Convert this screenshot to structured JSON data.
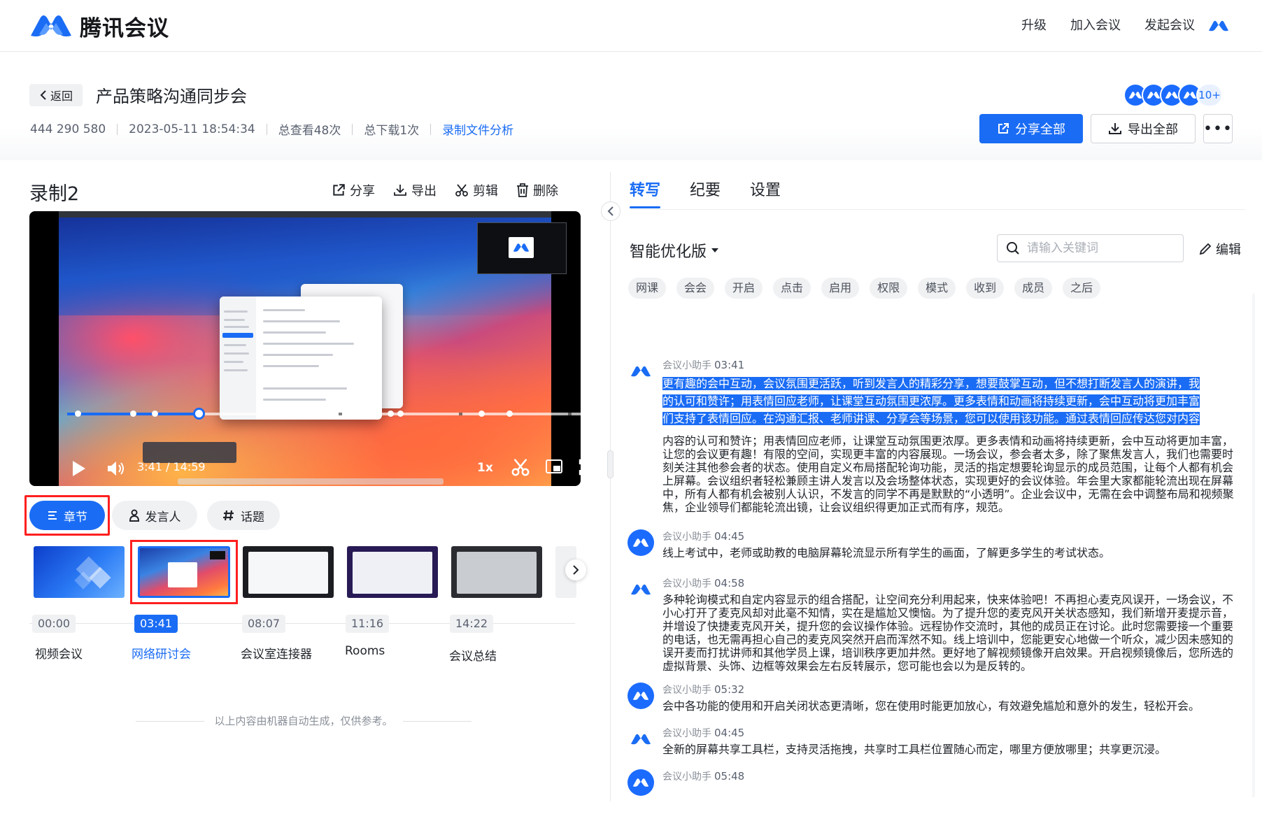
{
  "header": {
    "brand": "腾讯会议",
    "nav": [
      "升级",
      "加入会议",
      "发起会议"
    ]
  },
  "meeting": {
    "back_label": "返回",
    "title": "产品策略沟通同步会",
    "id": "444 290 580",
    "datetime": "2023-05-11 18:54:34",
    "views": "总查看48次",
    "downloads": "总下载1次",
    "analysis_link": "录制文件分析",
    "participants_more": "10+",
    "share_all": "分享全部",
    "export_all": "导出全部"
  },
  "recording": {
    "title": "录制2",
    "actions": [
      "分享",
      "导出",
      "剪辑",
      "删除"
    ],
    "time_current": "3:41",
    "time_total": "14:59",
    "speed": "1x",
    "progress": 0.246
  },
  "segments": [
    "章节",
    "发言人",
    "话题"
  ],
  "chapters": [
    {
      "time": "00:00",
      "label": "视频会议"
    },
    {
      "time": "03:41",
      "label": "网络研讨会"
    },
    {
      "time": "08:07",
      "label": "会议室连接器"
    },
    {
      "time": "11:16",
      "label": "Rooms"
    },
    {
      "time": "14:22",
      "label": "会议总结"
    }
  ],
  "footnote": "以上内容由机器自动生成，仅供参考。",
  "right": {
    "tabs": [
      "转写",
      "纪要",
      "设置"
    ],
    "version": "智能优化版",
    "search_placeholder": "请输入关键词",
    "edit": "编辑",
    "tags": [
      "网课",
      "会会",
      "开启",
      "点击",
      "启用",
      "权限",
      "模式",
      "收到",
      "成员",
      "之后"
    ],
    "speaker": "会议小助手",
    "entries": [
      {
        "time": "03:41",
        "hl1": "更有趣的会中互动，会议氛围更活跃，听到发言人的精彩分享，想要鼓掌互动，但不想打断发言人的演讲，我",
        "hl2": "的认可和赞许；用表情回应老师，让课堂互动氛围更浓厚。更多表情和动画将持续更新，会中互动将更加丰富",
        "hl3": "们支持了表情回应。在沟通汇报、老师讲课、分享会等场景，您可以使用该功能。通过表情回应传达您对内容",
        "text": "内容的认可和赞许；用表情回应老师，让课堂互动氛围更浓厚。更多表情和动画将持续更新，会中互动将更加丰富，让您的会议更有趣！有限的空间，实现更丰富的内容展现。一场会议，参会者太多，除了聚焦发言人，我们也需要时刻关注其他参会者的状态。使用自定义布局搭配轮询功能，灵活的指定想要轮询显示的成员范围，让每个人都有机会上屏幕。会议组织者轻松兼顾主讲人发言以及会场整体状态，实现更好的会议体验。年会里大家都能轮流出现在屏幕中，所有人都有机会被别人认识，不发言的同学不再是默默的“小透明”。企业会议中，无需在会中调整布局和视频聚焦，企业领导们都能轮流出镜，让会议组织得更加正式而有序，规范。"
      },
      {
        "time": "04:45",
        "text": "线上考试中，老师或助教的电脑屏幕轮流显示所有学生的画面，了解更多学生的考试状态。"
      },
      {
        "time": "04:58",
        "text": "多种轮询模式和自定内容显示的组合搭配，让空间充分利用起来，快来体验吧！不再担心麦克风误开，一场会议，不小心打开了麦克风却对此毫不知情，实在是尴尬又懊恼。为了提升您的麦克风开关状态感知，我们新增开麦提示音，并增设了快捷麦克风开关，提升您的会议操作体验。远程协作交流时，其他的成员正在讨论。此时您需要接一个重要的电话，也无需再担心自己的麦克风突然开启而浑然不知。线上培训中，您能更安心地做一个听众，减少因未感知的误开麦而打扰讲师和其他学员上课，培训秩序更加井然。更好地了解视频镜像开启效果。开启视频镜像后，您所选的虚拟背景、头饰、边框等效果会左右反转展示，您可能也会以为是反转的。"
      },
      {
        "time": "05:32",
        "text": "会中各功能的使用和开启关闭状态更清晰，您在使用时能更加放心，有效避免尴尬和意外的发生，轻松开会。"
      },
      {
        "time": "04:45",
        "text": "全新的屏幕共享工具栏，支持灵活拖拽，共享时工具栏位置随心而定，哪里方便放哪里；共享更沉浸。"
      },
      {
        "time": "05:48",
        "text": ""
      }
    ]
  },
  "colors": {
    "accent": "#1a6cf4",
    "highlight_border": "#ff1f1f"
  }
}
